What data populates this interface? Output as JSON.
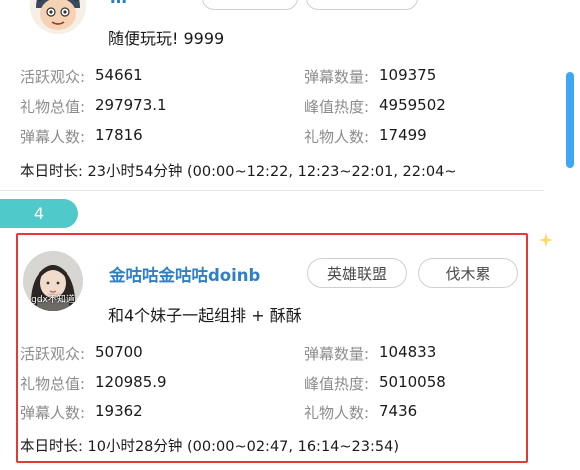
{
  "card_prev": {
    "description": "随便玩玩! 9999",
    "stats": {
      "active_viewers_label": "活跃观众:",
      "active_viewers": "54661",
      "danmu_count_label": "弹幕数量:",
      "danmu_count": "109375",
      "gift_total_label": "礼物总值:",
      "gift_total": "297973.1",
      "peak_heat_label": "峰值热度:",
      "peak_heat": "4959502",
      "danmu_users_label": "弹幕人数:",
      "danmu_users": "17816",
      "gift_users_label": "礼物人数:",
      "gift_users": "17499"
    },
    "duration_label": "本日时长:",
    "duration_value": "23小时54分钟 (00:00~12:22, 12:23~22:01, 22:04~"
  },
  "rank": "4",
  "card": {
    "name": "金咕咕金咕咕doinb",
    "tags": [
      "英雄联盟",
      "伐木累"
    ],
    "avatar_caption": "gdx不知道",
    "description": "和4个妹子一起组排 + 酥酥",
    "stats": {
      "active_viewers_label": "活跃观众:",
      "active_viewers": "50700",
      "danmu_count_label": "弹幕数量:",
      "danmu_count": "104833",
      "gift_total_label": "礼物总值:",
      "gift_total": "120985.9",
      "peak_heat_label": "峰值热度:",
      "peak_heat": "5010058",
      "danmu_users_label": "弹幕人数:",
      "danmu_users": "19362",
      "gift_users_label": "礼物人数:",
      "gift_users": "7436"
    },
    "duration_label": "本日时长:",
    "duration_value": "10小时28分钟 (00:00~02:47, 16:14~23:54)"
  },
  "colors": {
    "name_blue": "#2f7fc4",
    "rank_teal": "#4fc9c9",
    "highlight_red": "#e53935",
    "scrollbar_blue": "#3ea6f2",
    "label_gray": "#8c8c8c"
  },
  "icons": {
    "avatar_prev": "cartoon-avatar-icon",
    "sparkle": "sparkle-icon"
  }
}
